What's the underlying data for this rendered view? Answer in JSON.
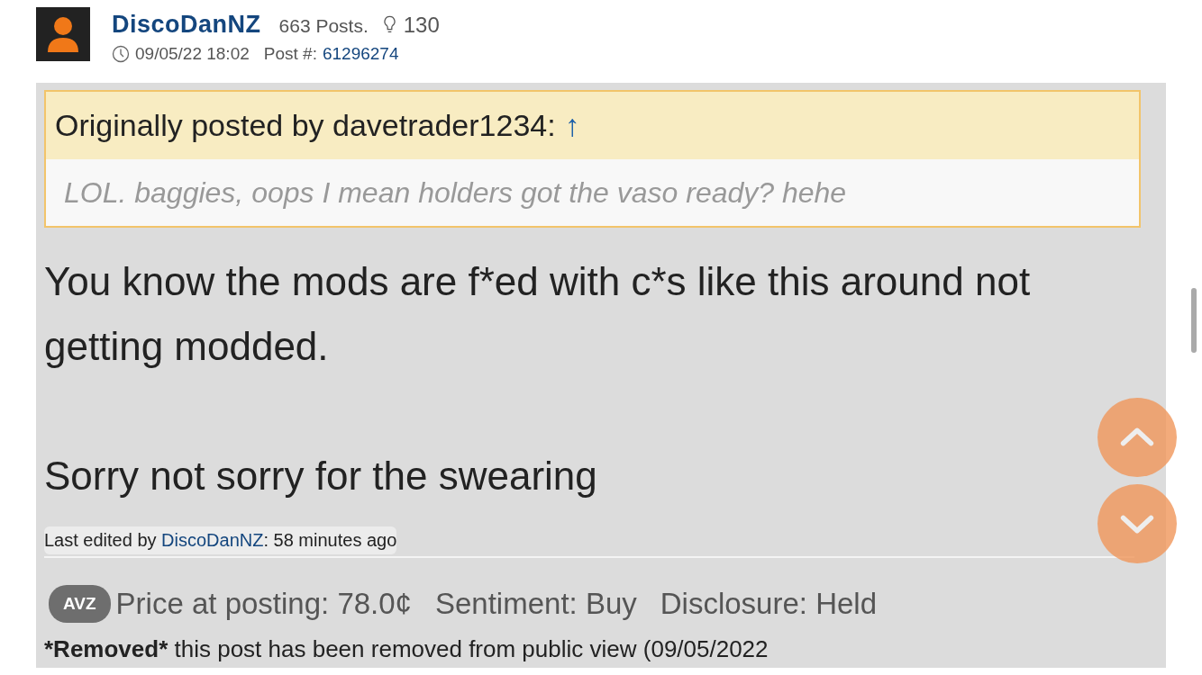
{
  "author": {
    "name": "DiscoDanNZ",
    "posts": "663 Posts.",
    "likes": "130",
    "time": "09/05/22 18:02",
    "post_label": "Post #:",
    "post_number": "61296274"
  },
  "quote": {
    "prefix": "Originally posted by davetrader1234:",
    "arrow": "↑",
    "text": "LOL. baggies, oops I mean holders got the vaso ready? hehe"
  },
  "body": [
    "You know the mods are f*ed with c*s like this around not getting modded.",
    "Sorry not sorry for the swearing"
  ],
  "edited": {
    "prefix": "Last edited by",
    "user": "DiscoDanNZ",
    "suffix": ": 58 minutes ago"
  },
  "stock": {
    "ticker": "AVZ",
    "price": "Price at posting: 78.0¢",
    "sentiment": "Sentiment: Buy",
    "disclosure": "Disclosure: Held"
  },
  "removed": {
    "label": "*Removed*",
    "text": "this post has been removed from public view (09/05/2022"
  }
}
